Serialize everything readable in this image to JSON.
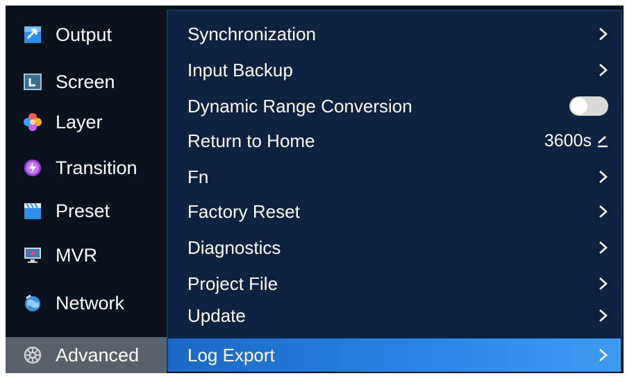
{
  "sidebar": {
    "items": [
      {
        "label": "Output",
        "icon": "output-icon"
      },
      {
        "label": "Screen",
        "icon": "screen-icon"
      },
      {
        "label": "Layer",
        "icon": "layer-icon"
      },
      {
        "label": "Transition",
        "icon": "transition-icon"
      },
      {
        "label": "Preset",
        "icon": "preset-icon"
      },
      {
        "label": "MVR",
        "icon": "mvr-icon"
      },
      {
        "label": "Network",
        "icon": "network-icon"
      },
      {
        "label": "Advanced",
        "icon": "gear-icon"
      }
    ],
    "active": "Advanced"
  },
  "menu": {
    "items": [
      {
        "label": "Synchronization",
        "control": "chevron"
      },
      {
        "label": "Input Backup",
        "control": "chevron"
      },
      {
        "label": "Dynamic Range Conversion",
        "control": "toggle",
        "state": "on"
      },
      {
        "label": "Return to Home",
        "control": "value",
        "value": "3600s"
      },
      {
        "label": "Fn",
        "control": "chevron"
      },
      {
        "label": "Factory Reset",
        "control": "chevron"
      },
      {
        "label": "Diagnostics",
        "control": "chevron"
      },
      {
        "label": "Project File",
        "control": "chevron"
      },
      {
        "label": "Update",
        "control": "chevron"
      },
      {
        "label": "Log Export",
        "control": "chevron"
      }
    ],
    "selected": "Log Export"
  },
  "colors": {
    "sidebar_bg": "#08111c",
    "panel_bg": "#0b2340",
    "selected_bg": "#2b87e6",
    "active_sidebar_bg": "#5a6168"
  }
}
